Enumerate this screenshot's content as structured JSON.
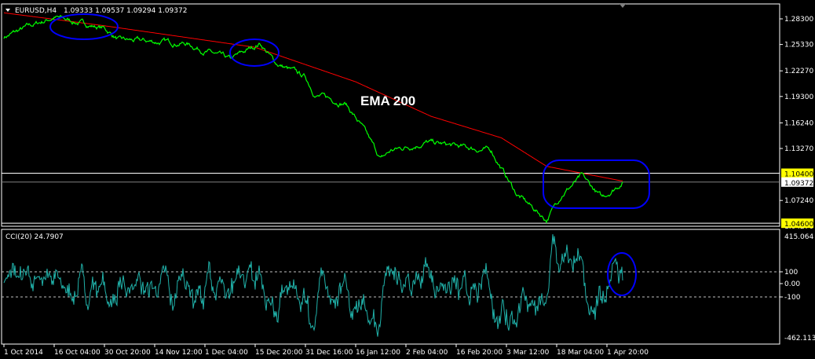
{
  "header": {
    "symbol": "EURUSD,H4",
    "ohlc": "1.09333 1.09537 1.09294 1.09372"
  },
  "indicator": {
    "label": "CCI(20) 24.7907"
  },
  "annotation": {
    "ema_label": "EMA 200"
  },
  "colors": {
    "price": "#00ff00",
    "ema": "#ff0000",
    "cci": "#20b2aa",
    "highlight": "#0000ff",
    "level_bg": "#ffff00"
  },
  "chart_data": [
    {
      "type": "line",
      "title": "EURUSD,H4",
      "price_ticks": [
        "1.28300",
        "1.25330",
        "1.22270",
        "1.19300",
        "1.16240",
        "1.13270",
        "1.07240"
      ],
      "price_tick_values": [
        1.283,
        1.2533,
        1.2227,
        1.193,
        1.1624,
        1.1327,
        1.0724
      ],
      "levels": [
        {
          "label": "1.10400",
          "value": 1.104
        },
        {
          "label": "1.04600",
          "value": 1.046
        }
      ],
      "hidden_tick": "1.04270",
      "current": {
        "label": "1.09372",
        "value": 1.09372
      },
      "x_ticks": [
        "1 Oct 2014",
        "16 Oct 04:00",
        "30 Oct 20:00",
        "14 Nov 12:00",
        "1 Dec 04:00",
        "15 Dec 20:00",
        "31 Dec 16:00",
        "16 Jan 12:00",
        "2 Feb 04:00",
        "16 Feb 20:00",
        "3 Mar 12:00",
        "18 Mar 04:00",
        "1 Apr 20:00"
      ],
      "series": [
        {
          "name": "EURUSD close",
          "x": [
            0,
            0.55,
            1,
            2,
            2.3,
            3.6,
            4.5,
            5.1,
            5.4,
            6,
            6.2,
            6.8,
            7.1,
            7.5,
            7.7,
            8.4,
            9,
            9.7,
            10.2,
            10.8,
            11.1,
            11.5,
            11.9,
            12.3
          ],
          "y": [
            1.262,
            1.275,
            1.285,
            1.272,
            1.258,
            1.255,
            1.235,
            1.255,
            1.232,
            1.215,
            1.195,
            1.185,
            1.16,
            1.12,
            1.13,
            1.14,
            1.135,
            1.13,
            1.08,
            1.05,
            1.08,
            1.1,
            1.075,
            1.0937
          ]
        },
        {
          "name": "EMA 200",
          "x": [
            0,
            2,
            5,
            7,
            8.5,
            9.9,
            10.8,
            12.3
          ],
          "y": [
            1.29,
            1.275,
            1.25,
            1.21,
            1.17,
            1.145,
            1.112,
            1.095
          ]
        }
      ],
      "ylim": [
        1.0427,
        1.29
      ]
    },
    {
      "type": "line",
      "title": "CCI(20) 24.7907",
      "y_ticks": [
        "415.064",
        "100",
        "0.00",
        "-100",
        "-462.1133"
      ],
      "y_tick_values": [
        415.064,
        100,
        0,
        -100,
        -462.1133
      ],
      "last_value": 24.7907,
      "ylim": [
        -462.1133,
        415.064
      ]
    }
  ]
}
